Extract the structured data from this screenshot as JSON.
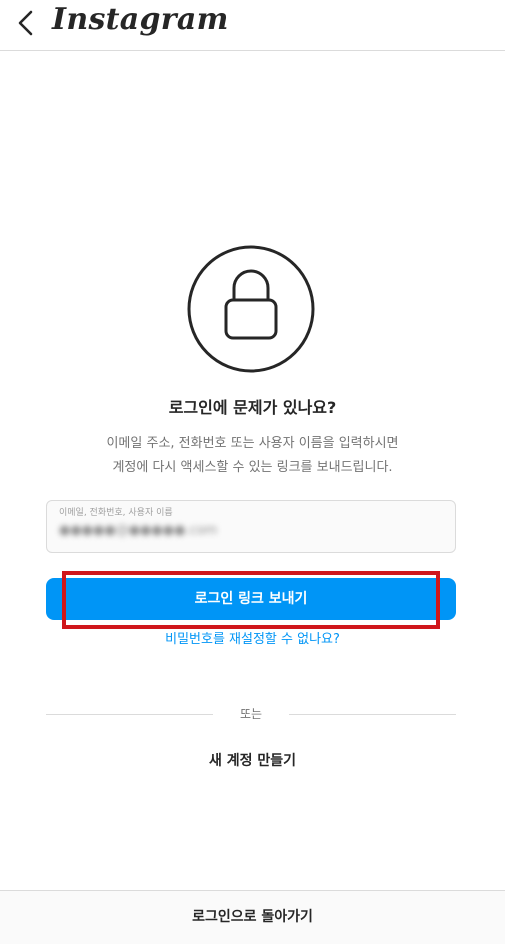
{
  "header": {
    "back_icon": "chevron-left-icon",
    "brand": "Instagram"
  },
  "main": {
    "lock_icon": "lock-icon",
    "title": "로그인에 문제가 있나요?",
    "description_line1": "이메일 주소, 전화번호 또는 사용자 이름을 입력하시면",
    "description_line2": "계정에 다시 액세스할 수 있는 링크를 보내드립니다.",
    "input_label": "이메일, 전화번호, 사용자 이름",
    "input_value": "●●●●●@●●●●●.com",
    "send_link_button": "로그인 링크 보내기",
    "reset_password_link": "비밀번호를 재설정할 수 없나요?",
    "or_text": "또는",
    "create_account": "새 계정 만들기"
  },
  "footer": {
    "back_to_login": "로그인으로 돌아가기"
  },
  "colors": {
    "accent": "#0095f6",
    "highlight": "#d0161b"
  }
}
